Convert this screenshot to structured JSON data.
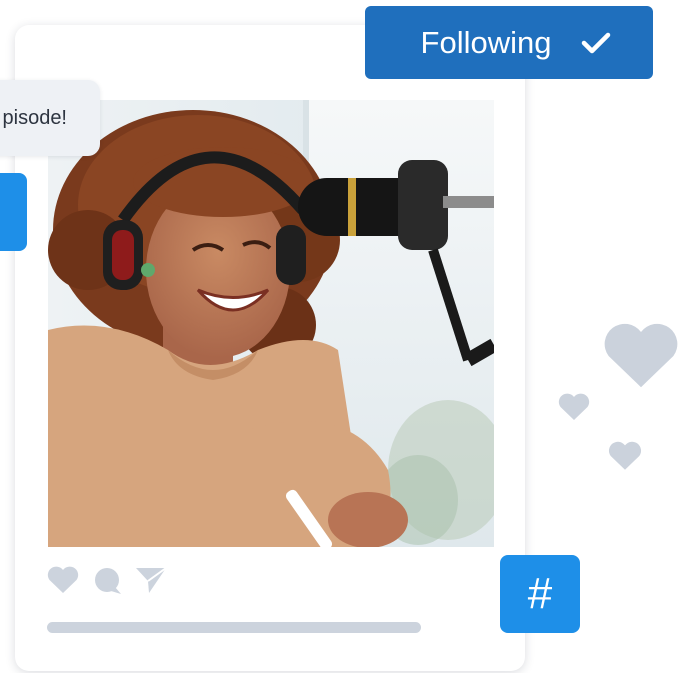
{
  "header": {
    "follow_label": "Following"
  },
  "comment": {
    "text": "pisode!"
  },
  "post": {
    "photo_alt": "",
    "progress": 0
  },
  "hashtag": {
    "symbol": "#"
  },
  "icons": {
    "follow": "check-icon",
    "like": "heart-icon",
    "comment": "comment-icon",
    "share": "send-icon",
    "floating": "heart-icon"
  },
  "colors": {
    "primary_blue": "#1f6fbd",
    "accent_blue": "#1e8fe8",
    "icon_gray": "#ccd3dd",
    "bubble_bg": "#eef1f5"
  }
}
